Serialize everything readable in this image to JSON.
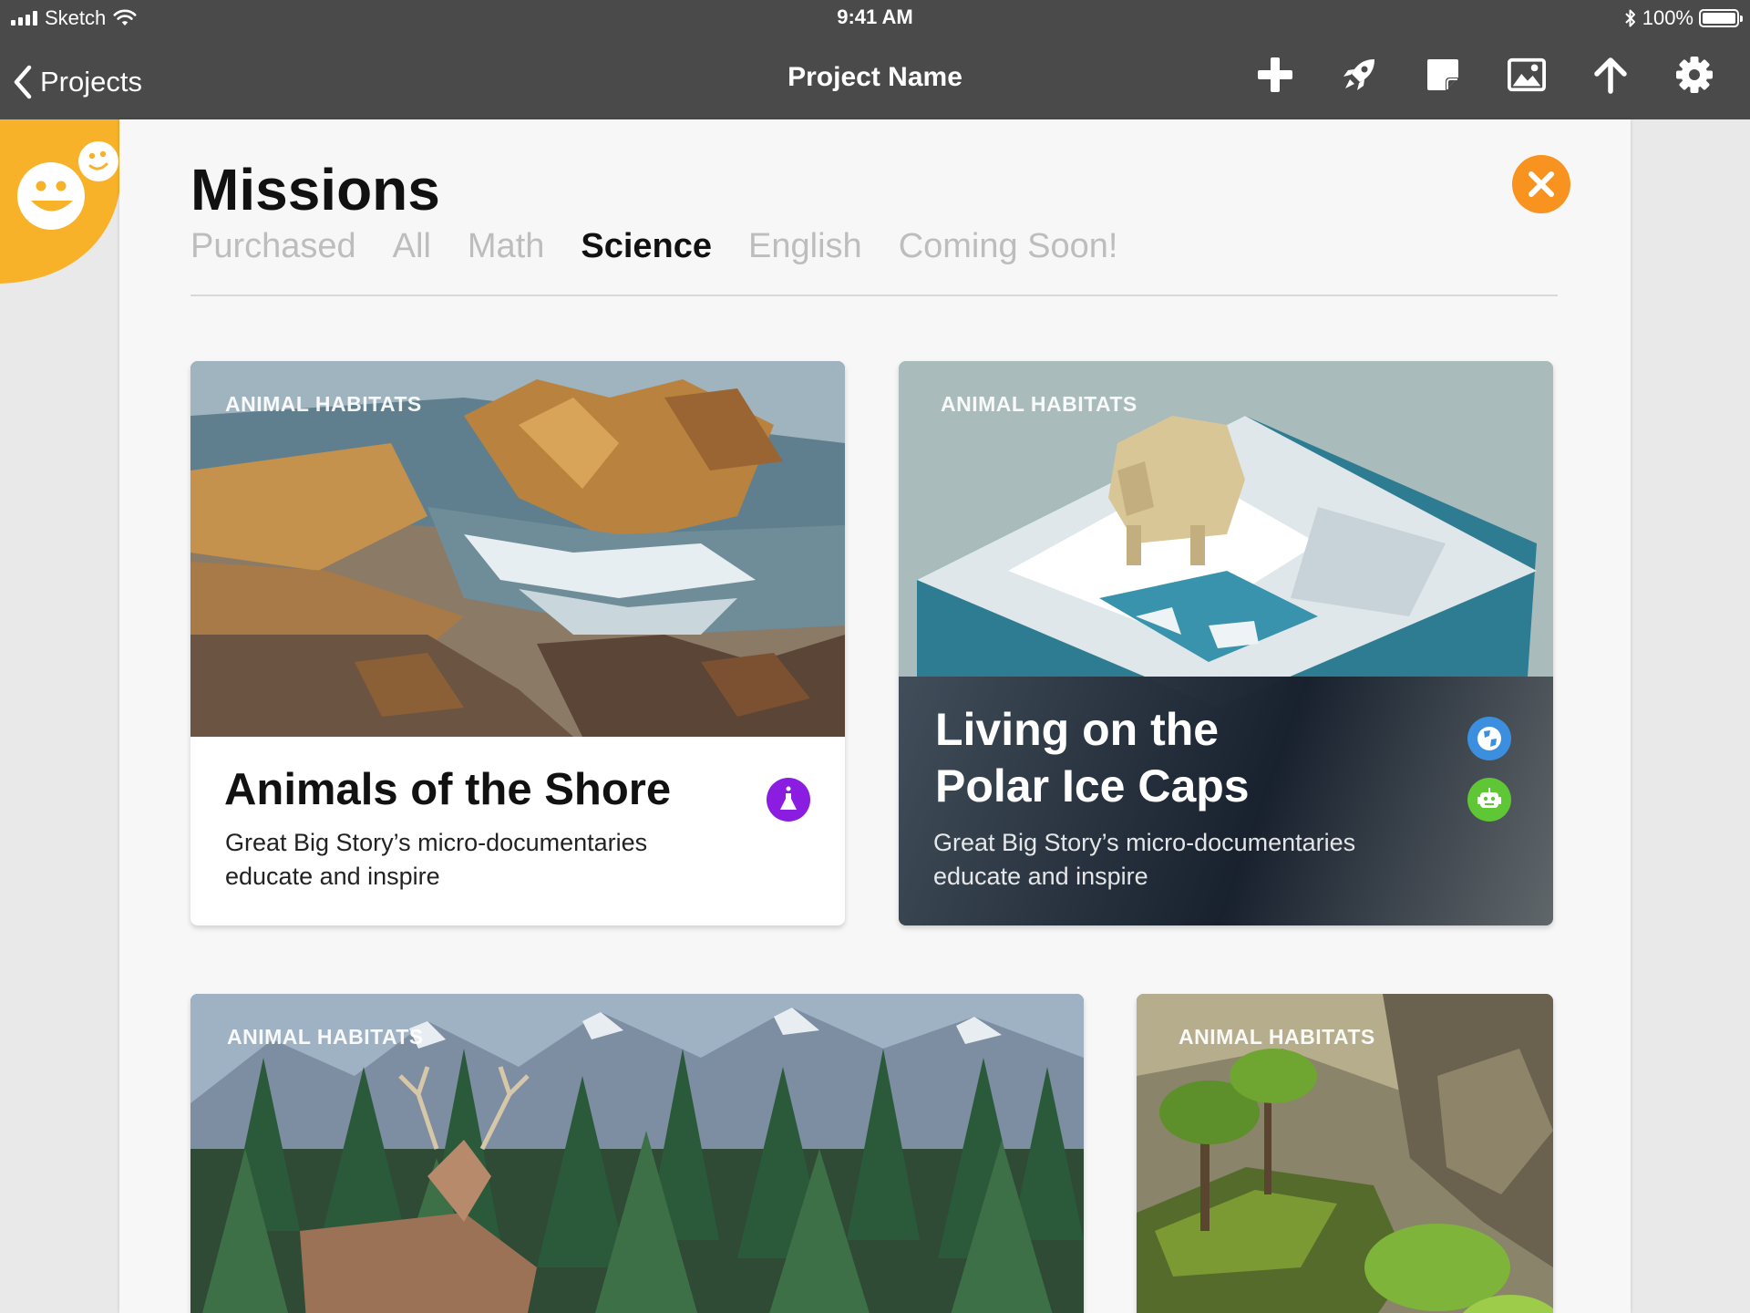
{
  "status_bar": {
    "carrier": "Sketch",
    "time": "9:41 AM",
    "battery": "100%",
    "battery_level": 1.0
  },
  "nav": {
    "back_label": "Projects",
    "title": "Project Name",
    "icons": [
      "plus-icon",
      "rocket-icon",
      "sticker-icon",
      "image-icon",
      "upload-icon",
      "gear-icon"
    ]
  },
  "missions": {
    "heading": "Missions",
    "tabs": [
      {
        "label": "Purchased",
        "active": false
      },
      {
        "label": "All",
        "active": false
      },
      {
        "label": "Math",
        "active": false
      },
      {
        "label": "Science",
        "active": true
      },
      {
        "label": "English",
        "active": false
      },
      {
        "label": "Coming Soon!",
        "active": false
      }
    ],
    "cards": [
      {
        "category": "ANIMAL HABITATS",
        "title_lines": [
          "Animals of the Shore"
        ],
        "description_lines": [
          "Great Big Story’s micro-documentaries",
          "educate and inspire"
        ],
        "badges": [
          "flask-icon"
        ]
      },
      {
        "category": "ANIMAL HABITATS",
        "title_lines": [
          "Living on the",
          "Polar Ice Caps"
        ],
        "description_lines": [
          "Great Big Story’s micro-documentaries",
          "educate and inspire"
        ],
        "badges": [
          "globe-icon",
          "robot-icon"
        ]
      },
      {
        "category": "ANIMAL HABITATS"
      },
      {
        "category": "ANIMAL HABITATS"
      }
    ]
  },
  "colors": {
    "topbar": "#4a4a4a",
    "accent_orange": "#f7931e",
    "mascot_yellow": "#f8b22a",
    "badge_purple": "#8a1de0",
    "badge_blue": "#3c8fde",
    "badge_green": "#5fc635"
  }
}
